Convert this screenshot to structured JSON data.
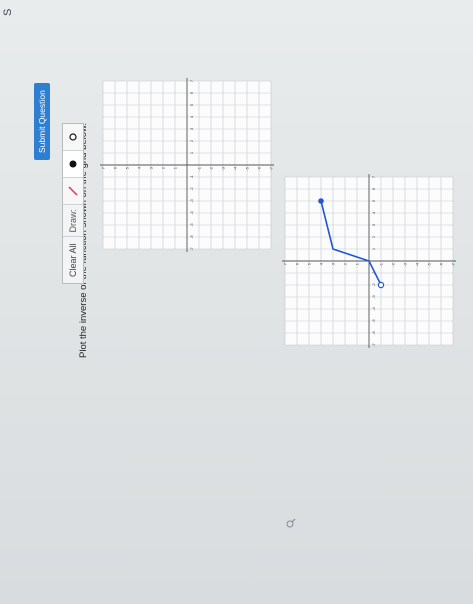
{
  "corner_mark": "S",
  "question": "Plot the inverse of the function shown on the grid below.",
  "toolbar": {
    "clear_label": "Clear All",
    "draw_label": "Draw:"
  },
  "tools": [
    "line-segment-tool",
    "filled-dot-tool",
    "open-dot-tool"
  ],
  "submit_label": "Submit Question",
  "colors": {
    "curve": "#2255d6",
    "submit": "#2e7fd0",
    "tool_line": "#e0344a"
  },
  "graph": {
    "x_range": [
      -7,
      7
    ],
    "y_range": [
      -7,
      7
    ],
    "x_tick_labels": [
      "-7",
      "-6",
      "-5",
      "-4",
      "-3",
      "-2",
      "-1",
      "1",
      "2",
      "3",
      "4",
      "5",
      "6",
      "7"
    ],
    "y_tick_labels": [
      "-7",
      "-6",
      "-5",
      "-4",
      "-3",
      "-2",
      "-1",
      "1",
      "2",
      "3",
      "4",
      "5",
      "6",
      "7"
    ],
    "function_points": [
      [
        -2,
        -1
      ],
      [
        0,
        0
      ],
      [
        1,
        3
      ],
      [
        5,
        4
      ]
    ],
    "open_endpoint": [
      -2,
      -1
    ],
    "closed_endpoint": [
      5,
      4
    ]
  }
}
